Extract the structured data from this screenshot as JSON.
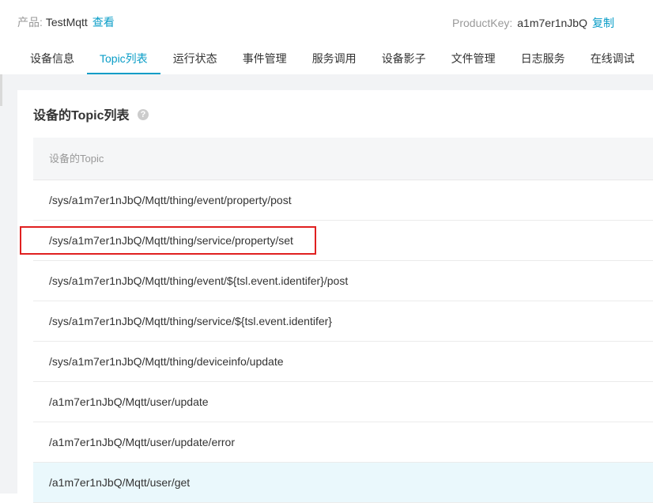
{
  "header": {
    "product_label": "产品:",
    "product_name": "TestMqtt",
    "product_view_link": "查看",
    "product_key_label": "ProductKey:",
    "product_key_value": "a1m7er1nJbQ",
    "copy_link": "复制"
  },
  "tabs": [
    {
      "label": "设备信息",
      "active": false
    },
    {
      "label": "Topic列表",
      "active": true
    },
    {
      "label": "运行状态",
      "active": false
    },
    {
      "label": "事件管理",
      "active": false
    },
    {
      "label": "服务调用",
      "active": false
    },
    {
      "label": "设备影子",
      "active": false
    },
    {
      "label": "文件管理",
      "active": false
    },
    {
      "label": "日志服务",
      "active": false
    },
    {
      "label": "在线调试",
      "active": false
    }
  ],
  "panel": {
    "title": "设备的Topic列表",
    "help_icon": "question-circle-icon",
    "help_glyph": "?"
  },
  "table": {
    "header": "设备的Topic",
    "rows": [
      "/sys/a1m7er1nJbQ/Mqtt/thing/event/property/post",
      "/sys/a1m7er1nJbQ/Mqtt/thing/service/property/set",
      "/sys/a1m7er1nJbQ/Mqtt/thing/event/${tsl.event.identifer}/post",
      "/sys/a1m7er1nJbQ/Mqtt/thing/service/${tsl.event.identifer}",
      "/sys/a1m7er1nJbQ/Mqtt/thing/deviceinfo/update",
      "/a1m7er1nJbQ/Mqtt/user/update",
      "/a1m7er1nJbQ/Mqtt/user/update/error",
      "/a1m7er1nJbQ/Mqtt/user/get"
    ]
  },
  "colors": {
    "accent": "#0a9dc7",
    "highlight_box": "#e02020",
    "hover_row": "#eaf8fc"
  }
}
